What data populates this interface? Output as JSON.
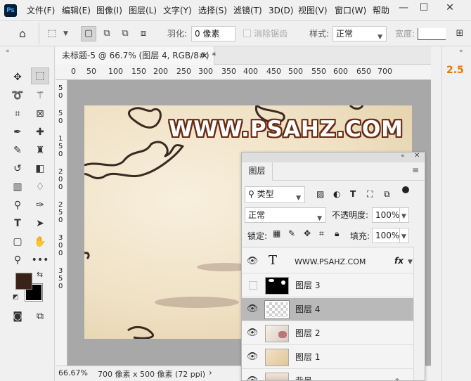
{
  "app": {
    "logo": "Ps"
  },
  "menu": [
    "文件(F)",
    "编辑(E)",
    "图像(I)",
    "图层(L)",
    "文字(Y)",
    "选择(S)",
    "滤镜(T)",
    "3D(D)",
    "视图(V)",
    "窗口(W)",
    "帮助"
  ],
  "window_controls": {
    "minimize": "—",
    "maximize": "☐",
    "close": "✕"
  },
  "options": {
    "feather_label": "羽化:",
    "feather_value": "0 像素",
    "antialias_label": "消除锯齿",
    "style_label": "样式:",
    "style_value": "正常",
    "width_label": "宽度:"
  },
  "document": {
    "tab_title": "未标题-5 @ 66.7% (图层 4, RGB/8#) *",
    "close_symbol": "×",
    "zoom": "66.67%",
    "doc_info": "700 像素 x 500 像素 (72 ppi)",
    "canvas_text": "WWW.PSAHZ.COM",
    "ruler_top": [
      "0",
      "50",
      "100",
      "150",
      "200",
      "250",
      "300",
      "350",
      "400",
      "450",
      "500",
      "550",
      "600",
      "650",
      "700"
    ],
    "ruler_left": [
      "5",
      "0",
      "5",
      "0",
      "1",
      "5",
      "0",
      "2",
      "0",
      "0",
      "2",
      "5",
      "0",
      "3",
      "0",
      "0",
      "3",
      "5",
      "0"
    ]
  },
  "right_panel": {
    "value": "2.5",
    "accent_color": "#e87a00"
  },
  "layers_panel": {
    "title": "图层",
    "filter_label": "类型",
    "blend_mode": "正常",
    "opacity_label": "不透明度:",
    "opacity_value": "100%",
    "lock_label": "锁定:",
    "fill_label": "填充:",
    "fill_value": "100%",
    "fx_label": "fx",
    "layers": [
      {
        "name": "WWW.PSAHZ.COM",
        "type": "text",
        "visible": true,
        "selected": false
      },
      {
        "name": "图层 3",
        "type": "mask",
        "visible": false,
        "selected": false
      },
      {
        "name": "图层 4",
        "type": "transparent",
        "visible": true,
        "selected": true
      },
      {
        "name": "图层 2",
        "type": "image",
        "visible": true,
        "selected": false
      },
      {
        "name": "图层 1",
        "type": "paper",
        "visible": true,
        "selected": false
      },
      {
        "name": "背景",
        "type": "background",
        "visible": true,
        "selected": false
      }
    ]
  },
  "colors": {
    "foreground": "#3b2218",
    "background": "#000000",
    "selected_layer": "#b9b9b9"
  }
}
